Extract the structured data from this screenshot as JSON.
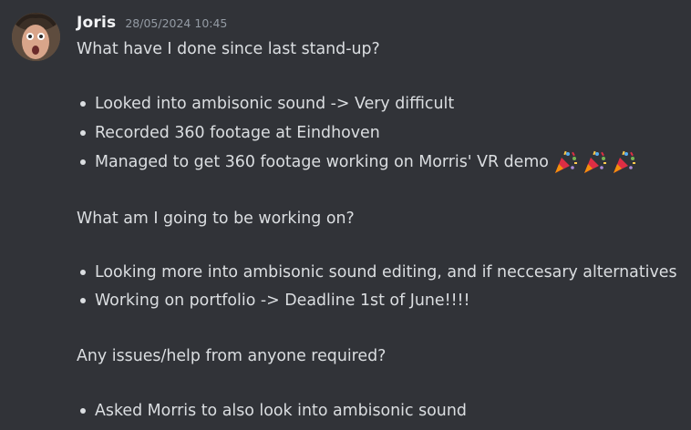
{
  "message": {
    "author": "Joris",
    "timestamp": "28/05/2024 10:45",
    "question_1": "What have I done since last stand-up?",
    "done_items": [
      "Looked into ambisonic sound -> Very difficult",
      "Recorded 360 footage at Eindhoven",
      "Managed to get 360 footage working on Morris' VR demo"
    ],
    "celebration_emoji": [
      "party-popper-icon",
      "party-popper-icon",
      "party-popper-icon"
    ],
    "question_2": "What am I going to be working on?",
    "todo_items": [
      "Looking more into ambisonic sound editing, and if neccesary alternatives",
      "Working on portfolio -> Deadline 1st of June!!!!"
    ],
    "question_3": "Any issues/help from anyone required?",
    "help_items": [
      "Asked Morris to also look into ambisonic sound"
    ]
  },
  "colors": {
    "background": "#313338",
    "text": "#dbdee1",
    "username": "#f2f3f5",
    "timestamp": "#949ba4"
  }
}
